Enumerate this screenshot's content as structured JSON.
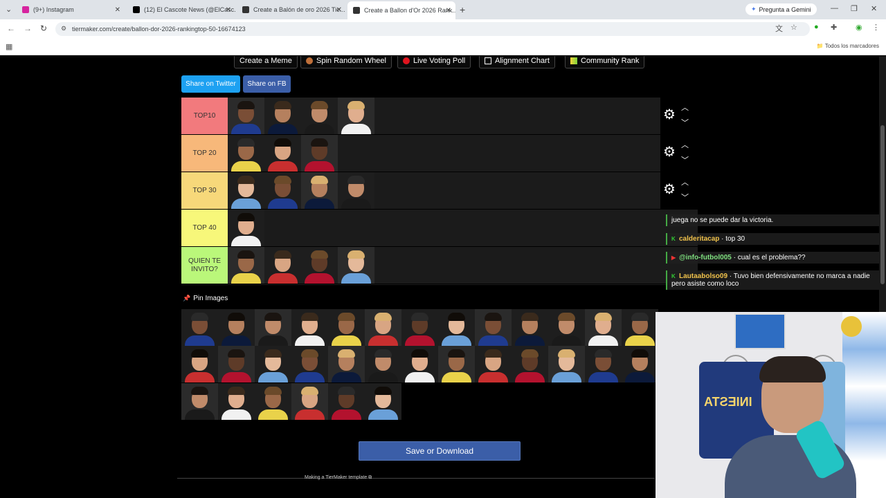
{
  "browser": {
    "tabs": [
      {
        "label": "(9+) Instagram",
        "fav_color": "#d6249f",
        "active": false
      },
      {
        "label": "(12) El Cascote News (@ElCasc...",
        "fav_color": "#000000",
        "active": false
      },
      {
        "label": "Create a Balón de oro 2026 Tie...",
        "fav_color": "#222222",
        "active": false
      },
      {
        "label": "Create a Ballon d'Or 2026 Rank...",
        "fav_color": "#222222",
        "active": true
      }
    ],
    "gemini_label": "Pregunta a Gemini",
    "url": "tiermaker.com/create/ballon-dor-2026-rankingtop-50-16674123",
    "bookmarks_label": "Todos los marcadores"
  },
  "toolbar": {
    "buttons": [
      "Create a Meme",
      "Spin Random Wheel",
      "Live Voting Poll",
      "Alignment Chart",
      "Community Rank"
    ]
  },
  "share": {
    "twitter": "Share on Twitter",
    "fb": "Share on FB",
    "twitter_color": "#1da1f2",
    "fb_color": "#3b5ea8"
  },
  "tiers": [
    {
      "label": "TOP10",
      "color": "#f27a7d",
      "players": 4
    },
    {
      "label": "TOP 20",
      "color": "#f7b87a",
      "players": 3
    },
    {
      "label": "TOP 30",
      "color": "#f7d87a",
      "players": 4
    },
    {
      "label": "TOP 40",
      "color": "#f7f77a",
      "players": 1
    },
    {
      "label": "QUIEN TE INVITO?",
      "color": "#baf77a",
      "players": 4
    }
  ],
  "pin_label": "Pin Images",
  "pool_count": 32,
  "save_label": "Save or Download",
  "footer_text": "Making a TierMaker template ⧉",
  "chat": [
    {
      "user": "",
      "text": "juega no se puede dar la victoria."
    },
    {
      "user": "calderitacap",
      "text": "top 30",
      "user_color": "#f0c24b"
    },
    {
      "user": "@info-futbol005",
      "text": "cual es el problema??",
      "user_color": "#7fe07f"
    },
    {
      "user": "Lautaabolso09",
      "text": "Tuvo bien defensivamente no marca a nadie pero asiste como loco",
      "user_color": "#f0c24b"
    }
  ],
  "webcam_jersey_text": "INIESTA"
}
